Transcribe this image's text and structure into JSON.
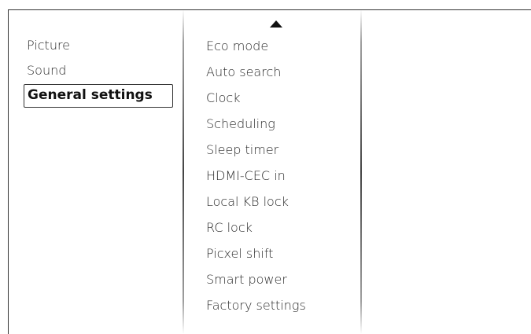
{
  "main_menu": {
    "items": [
      {
        "label": "Picture"
      },
      {
        "label": "Sound"
      },
      {
        "label": "General settings",
        "selected": true
      }
    ]
  },
  "submenu": {
    "scroll_up_icon": "triangle-up",
    "items": [
      {
        "label": "Eco mode"
      },
      {
        "label": "Auto search"
      },
      {
        "label": "Clock"
      },
      {
        "label": "Scheduling"
      },
      {
        "label": "Sleep timer"
      },
      {
        "label": "HDMI-CEC in"
      },
      {
        "label": "Local KB lock"
      },
      {
        "label": "RC lock"
      },
      {
        "label": "Picxel shift"
      },
      {
        "label": "Smart power"
      },
      {
        "label": "Factory settings"
      }
    ]
  },
  "colors": {
    "background": "#ffffff",
    "text": "#2a2a2a",
    "rule": "#333333"
  }
}
